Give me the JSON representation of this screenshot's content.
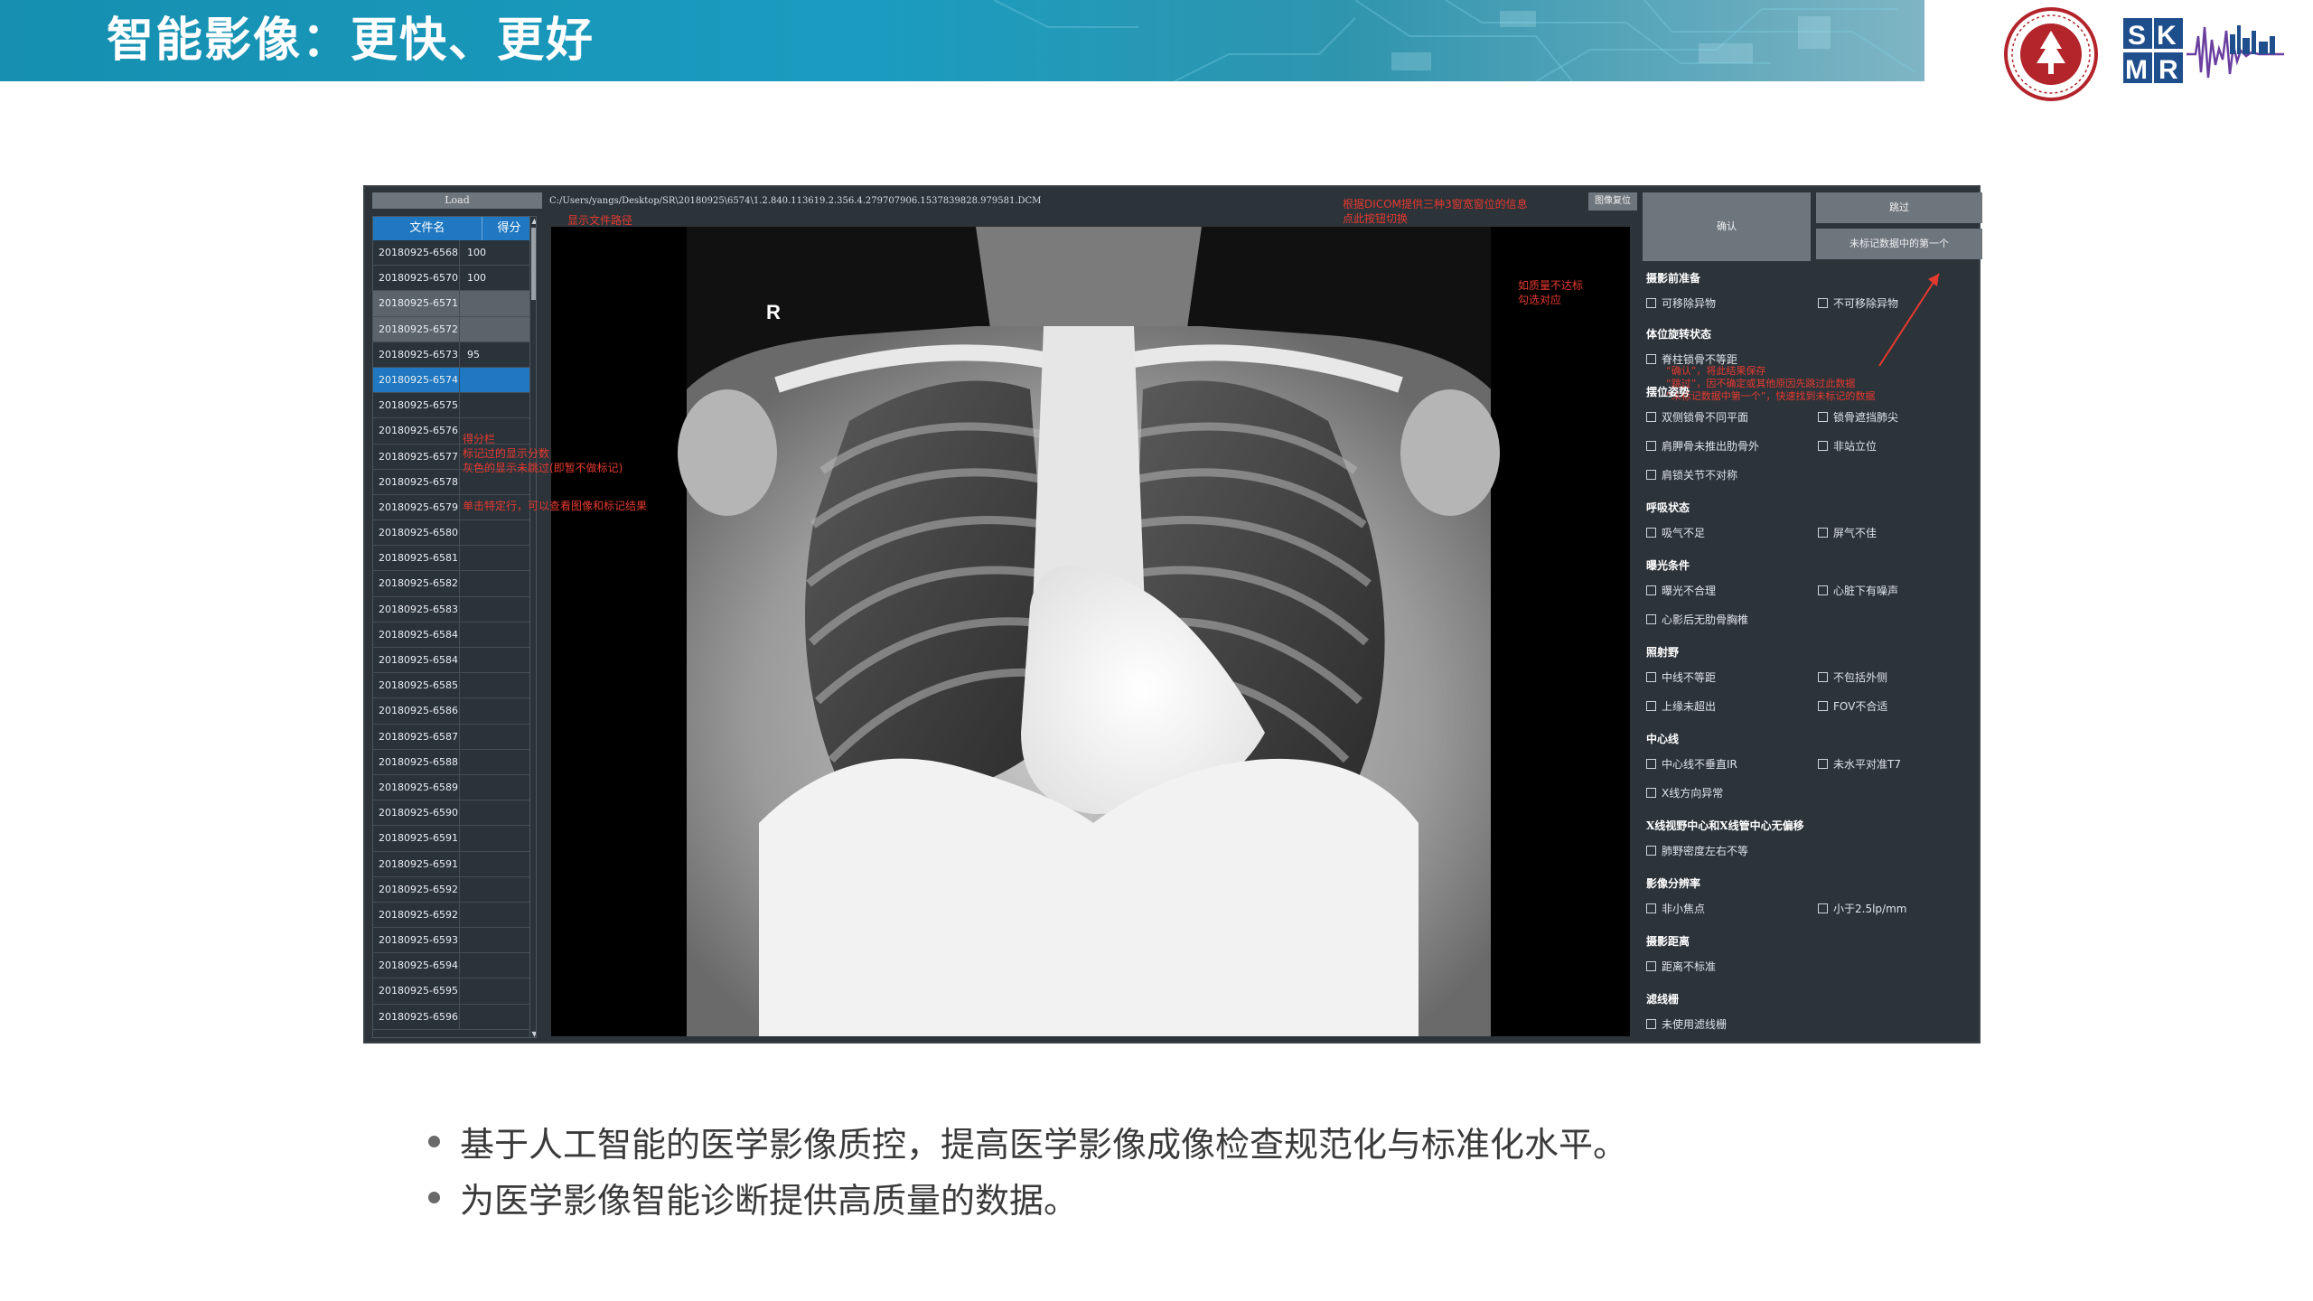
{
  "slide": {
    "title": "智能影像：更快、更好"
  },
  "app": {
    "load_label": "Load",
    "path": "C:/Users/yangs/Desktop/SR\\20180925\\6574\\1.2.840.113619.2.356.4.279707906.1537839828.979581.DCM",
    "reset_label": "图像复位",
    "confirm_label": "确认",
    "skip_label": "跳过",
    "next_label": "未标记数据中的第一个",
    "table": {
      "headers": [
        "文件名",
        "得分"
      ],
      "rows": [
        {
          "name": "20180925-6568",
          "score": "100",
          "state": ""
        },
        {
          "name": "20180925-6570",
          "score": "100",
          "state": ""
        },
        {
          "name": "20180925-6571",
          "score": "",
          "state": "grey"
        },
        {
          "name": "20180925-6572",
          "score": "",
          "state": "grey"
        },
        {
          "name": "20180925-6573",
          "score": "95",
          "state": ""
        },
        {
          "name": "20180925-6574",
          "score": "",
          "state": "selected"
        },
        {
          "name": "20180925-6575",
          "score": "",
          "state": ""
        },
        {
          "name": "20180925-6576",
          "score": "",
          "state": ""
        },
        {
          "name": "20180925-6577",
          "score": "",
          "state": ""
        },
        {
          "name": "20180925-6578",
          "score": "",
          "state": ""
        },
        {
          "name": "20180925-6579",
          "score": "",
          "state": ""
        },
        {
          "name": "20180925-6580",
          "score": "",
          "state": ""
        },
        {
          "name": "20180925-6581",
          "score": "",
          "state": ""
        },
        {
          "name": "20180925-6582",
          "score": "",
          "state": ""
        },
        {
          "name": "20180925-6583",
          "score": "",
          "state": ""
        },
        {
          "name": "20180925-6584",
          "score": "",
          "state": ""
        },
        {
          "name": "20180925-6584",
          "score": "",
          "state": ""
        },
        {
          "name": "20180925-6585",
          "score": "",
          "state": ""
        },
        {
          "name": "20180925-6586",
          "score": "",
          "state": ""
        },
        {
          "name": "20180925-6587",
          "score": "",
          "state": ""
        },
        {
          "name": "20180925-6588",
          "score": "",
          "state": ""
        },
        {
          "name": "20180925-6589",
          "score": "",
          "state": ""
        },
        {
          "name": "20180925-6590",
          "score": "",
          "state": ""
        },
        {
          "name": "20180925-6591",
          "score": "",
          "state": ""
        },
        {
          "name": "20180925-6591",
          "score": "",
          "state": ""
        },
        {
          "name": "20180925-6592",
          "score": "",
          "state": ""
        },
        {
          "name": "20180925-6592",
          "score": "",
          "state": ""
        },
        {
          "name": "20180925-6593",
          "score": "",
          "state": ""
        },
        {
          "name": "20180925-6594",
          "score": "",
          "state": ""
        },
        {
          "name": "20180925-6595",
          "score": "",
          "state": ""
        },
        {
          "name": "20180925-6596",
          "score": "",
          "state": ""
        }
      ]
    },
    "xray_marker": "R",
    "annotations": {
      "path_hint": "显示文件路径",
      "dicom_hint_1": "根据DICOM提供三种3窗宽窗位的信息",
      "dicom_hint_2": "点此按钮切换",
      "quality_hint_1": "如质量不达标",
      "quality_hint_2": "勾选对应",
      "score_hint_1": "得分栏",
      "score_hint_2": "标记过的显示分数",
      "score_hint_3": "灰色的显示未跳过(即暂不做标记)",
      "row_hint": "单击特定行，可以查看图像和标记结果",
      "buttons_hint_1": "“确认”，将此结果保存",
      "buttons_hint_2": "“跳过”，因不确定或其他原因先跳过此数据",
      "buttons_hint_3": "“未标记数据中第一个”，快速找到未标记的数据"
    },
    "sections": {
      "s1": "摄影前准备",
      "s2": "体位旋转状态",
      "s3": "摆位姿势",
      "s4": "呼吸状态",
      "s5": "曝光条件",
      "s6": "照射野",
      "s7": "中心线",
      "s8": "X线视野中心和X线管中心无偏移",
      "s9": "影像分辨率",
      "s10": "摄影距离",
      "s11": "滤线栅"
    },
    "checks": {
      "c1": "可移除异物",
      "c2": "不可移除异物",
      "c3": "脊柱锁骨不等距",
      "c4": "双侧锁骨不同平面",
      "c5": "锁骨遮挡肺尖",
      "c6": "肩胛骨未推出肋骨外",
      "c7": "非站立位",
      "c8": "肩锁关节不对称",
      "c9": "吸气不足",
      "c10": "屏气不佳",
      "c11": "曝光不合理",
      "c12": "心脏下有噪声",
      "c13": "心影后无肋骨胸椎",
      "c14": "中线不等距",
      "c15": "不包括外侧",
      "c16": "上缘未超出",
      "c17": "FOV不合适",
      "c18": "中心线不垂直IR",
      "c19": "未水平对准T7",
      "c20": "X线方向异常",
      "c21": "肺野密度左右不等",
      "c22": "非小焦点",
      "c23": "小于2.5lp/mm",
      "c24": "距离不标准",
      "c25": "未使用滤线栅"
    }
  },
  "bullets": [
    "基于人工智能的医学影像质控，提高医学影像成像检查规范化与标准化水平。",
    "为医学影像智能诊断提供高质量的数据。"
  ],
  "colors": {
    "header": "#1a9cc0",
    "selected_row": "#1f78c1",
    "annotation": "#e53a30",
    "panel": "#2c3339"
  },
  "icons": [
    "ecnu-seal-logo",
    "skmr-logo"
  ]
}
